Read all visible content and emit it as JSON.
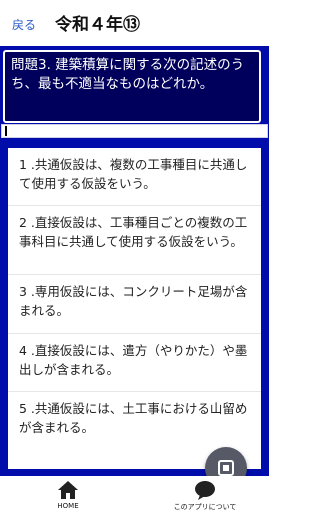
{
  "header": {
    "back_label": "戻る",
    "title": "令和４年⑬"
  },
  "question": {
    "text": "問題3. 建築積算に関する次の記述のうち、最も不適当なものはどれか。"
  },
  "input": {
    "value": ""
  },
  "options": [
    {
      "label": "1 .共通仮設は、複数の工事種目に共通して使用する仮設をいう。"
    },
    {
      "label": "2 .直接仮設は、工事種目ごとの複数の工事科目に共通して使用する仮設をいう。"
    },
    {
      "label": "3 .専用仮設には、コンクリート足場が含まれる。"
    },
    {
      "label": "4 .直接仮設には、遣方（やりかた）や墨出しが含まれる。"
    },
    {
      "label": "5 .共通仮設には、土工事における山留めが含まれる。"
    }
  ],
  "nav": {
    "home_label": "HOME",
    "about_label": "このアプリについて",
    "home_icon": "home-icon",
    "about_icon": "chat-bubble-icon"
  },
  "colors": {
    "panel": "#000dab",
    "question_bg": "#00005c",
    "back_link": "#2b5cc9",
    "fab": "#555a66"
  }
}
